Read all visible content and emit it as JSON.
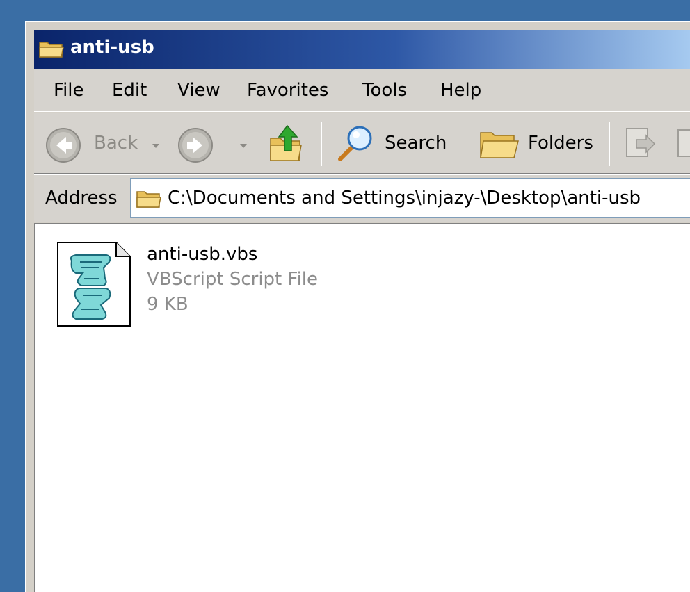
{
  "window": {
    "title": "anti-usb"
  },
  "menu": {
    "items": [
      "File",
      "Edit",
      "View",
      "Favorites",
      "Tools",
      "Help"
    ]
  },
  "toolbar": {
    "back_label": "Back",
    "search_label": "Search",
    "folders_label": "Folders"
  },
  "address": {
    "label": "Address",
    "path": "C:\\Documents and Settings\\injazy-\\Desktop\\anti-usb"
  },
  "files": [
    {
      "name": "anti-usb.vbs",
      "type": "VBScript Script File",
      "size": "9 KB",
      "icon": "vbscript-file-icon"
    }
  ],
  "colors": {
    "desktop": "#3a6ea5",
    "title_start": "#0a246a",
    "title_end": "#a6caf0",
    "chrome": "#d6d3ce",
    "secondary_text": "#8c8c8c"
  }
}
